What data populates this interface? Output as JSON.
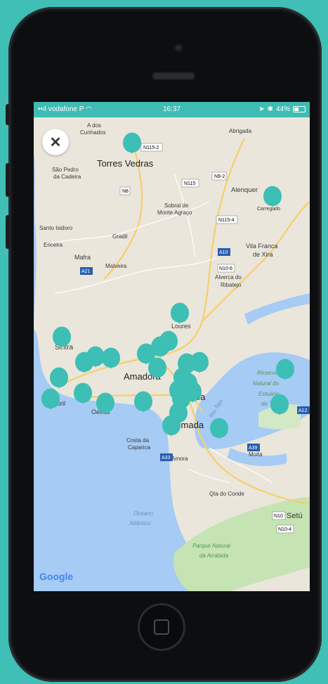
{
  "status_bar": {
    "carrier": "vodafone P",
    "time": "16:37",
    "battery": "44%"
  },
  "close_button": {
    "label": "✕"
  },
  "map": {
    "places": {
      "a_dos_cunhados_1": "A dos",
      "a_dos_cunhados_2": "Cunhados",
      "torres_vedras": "Torres Vedras",
      "sao_pedro_1": "São Pedro",
      "sao_pedro_2": "da Cadeira",
      "abrigada": "Abrigada",
      "alenquer": "Alenquer",
      "carregado": "Carregado",
      "sobral_1": "Sobral de",
      "sobral_2": "Monte Agraço",
      "santo_isidoro": "Santo Isidoro",
      "ericeira": "Ericeira",
      "gradil": "Gradil",
      "mafra": "Mafra",
      "malveira": "Malveira",
      "vila_franca_1": "Vila Franca",
      "vila_franca_2": "de Xira",
      "alverca_1": "Alverca do",
      "alverca_2": "Ribatejo",
      "loures": "Loures",
      "sintra": "Sintra",
      "amadora": "Amadora",
      "lisboa": "Lisboa",
      "estoril": "Estoril",
      "oeiras": "Oeiras",
      "almada": "Almada",
      "costa_1": "Costa da",
      "costa_2": "Caparica",
      "amora": "Amora",
      "moita": "Moita",
      "quinta_conde": "Qta do Conde",
      "setubal": "Setú",
      "reserva_1": "Reserva",
      "reserva_2": "Natural do",
      "reserva_3": "Estuário",
      "reserva_4": "do Tejo",
      "rio_tejo": "Rio Tejo",
      "oceano_1": "Oceano",
      "oceano_2": "Atlântico",
      "arrabida_1": "Parque Natural",
      "arrabida_2": "da Arrábida"
    },
    "roads": {
      "n115_2": "N115-2",
      "n8": "N8",
      "n115": "N115",
      "n9_2": "N9-2",
      "n115_4": "N115-4",
      "a10": "A10",
      "n10_6": "N10-6",
      "a21": "A21",
      "a39": "A39",
      "a33": "A33",
      "n10": "N10",
      "a12": "A12",
      "n10_4": "N10-4"
    },
    "google_logo": "Google"
  },
  "colors": {
    "background": "#3fbfb5",
    "pin": "#3dbfb5",
    "water": "#a6cbf5",
    "land": "#eae6dc",
    "park": "#c6e3b3"
  }
}
